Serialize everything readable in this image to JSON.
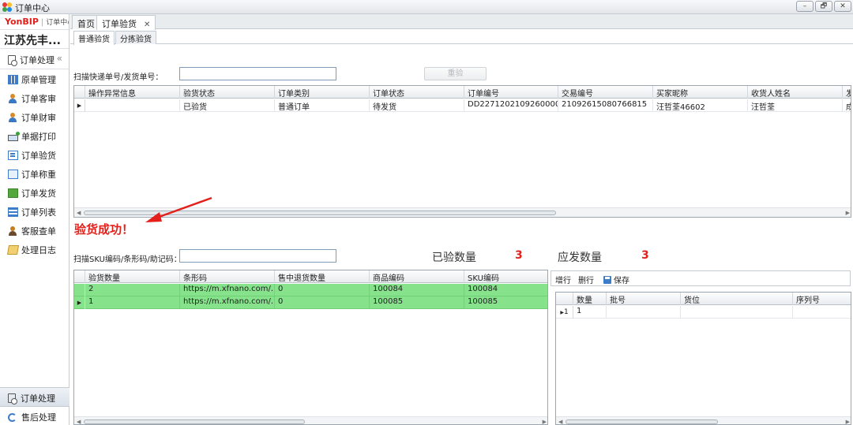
{
  "window": {
    "title": "订单中心",
    "controls": [
      "–",
      "🗗",
      "✕"
    ]
  },
  "sidebar": {
    "brand": "YonBIP",
    "brand_sub": "订单中心",
    "company": "江苏先丰...",
    "group_label": "订单处理",
    "items": [
      {
        "label": "原单管理",
        "icon": "grid-icon"
      },
      {
        "label": "订单客审",
        "icon": "user-icon"
      },
      {
        "label": "订单财审",
        "icon": "user-icon"
      },
      {
        "label": "单据打印",
        "icon": "printer-icon"
      },
      {
        "label": "订单验货",
        "icon": "check-list-icon"
      },
      {
        "label": "订单称重",
        "icon": "scale-icon"
      },
      {
        "label": "订单发货",
        "icon": "shipping-icon"
      },
      {
        "label": "订单列表",
        "icon": "list-icon"
      },
      {
        "label": "客服查单",
        "icon": "service-icon"
      },
      {
        "label": "处理日志",
        "icon": "log-icon"
      }
    ],
    "bottom": [
      {
        "label": "订单处理",
        "icon": "document-icon",
        "active": true
      },
      {
        "label": "售后处理",
        "icon": "refresh-icon",
        "active": false
      }
    ]
  },
  "tabs": {
    "home": "首页",
    "active": "订单验货",
    "close": "✕"
  },
  "subtabs": {
    "normal": "普通验货",
    "sort": "分拣验货"
  },
  "scan_order": {
    "label": "扫描快递单号/发货单号：",
    "value": "",
    "recheck": "重验"
  },
  "orders_grid": {
    "columns": [
      "操作异常信息",
      "验货状态",
      "订单类别",
      "订单状态",
      "订单编号",
      "交易编号",
      "买家昵称",
      "收货人姓名",
      "发"
    ],
    "rows": [
      [
        "",
        "已验货",
        "普通订单",
        "待发货",
        "DD227120210926000025",
        "21092615080766815",
        "汪哲荃46602",
        "汪哲荃",
        "成"
      ]
    ]
  },
  "success_message": "验货成功！",
  "scan_sku": {
    "label": "扫描SKU编码/条形码/助记码：",
    "value": ""
  },
  "stats": {
    "checked_label": "已验数量",
    "checked_value": "3",
    "expected_label": "应发数量",
    "expected_value": "3"
  },
  "sku_grid": {
    "columns": [
      "验货数量",
      "条形码",
      "售中退货数量",
      "商品编码",
      "SKU编码"
    ],
    "rows": [
      [
        "2",
        "https://m.xfnano.com/...",
        "0",
        "100084",
        "100084"
      ],
      [
        "1",
        "https://m.xfnano.com/...",
        "0",
        "100085",
        "100085"
      ]
    ]
  },
  "batch_toolbar": {
    "add": "增行",
    "delete": "删行",
    "save": "保存"
  },
  "batch_grid": {
    "columns": [
      "数量",
      "批号",
      "货位",
      "序列号"
    ],
    "rows": [
      {
        "indicator": "1",
        "values": [
          "1",
          "",
          "",
          ""
        ]
      }
    ]
  },
  "colors": {
    "accent_red": "#e3201b",
    "row_green": "#86e38b",
    "brand_red": "#e0201c"
  }
}
